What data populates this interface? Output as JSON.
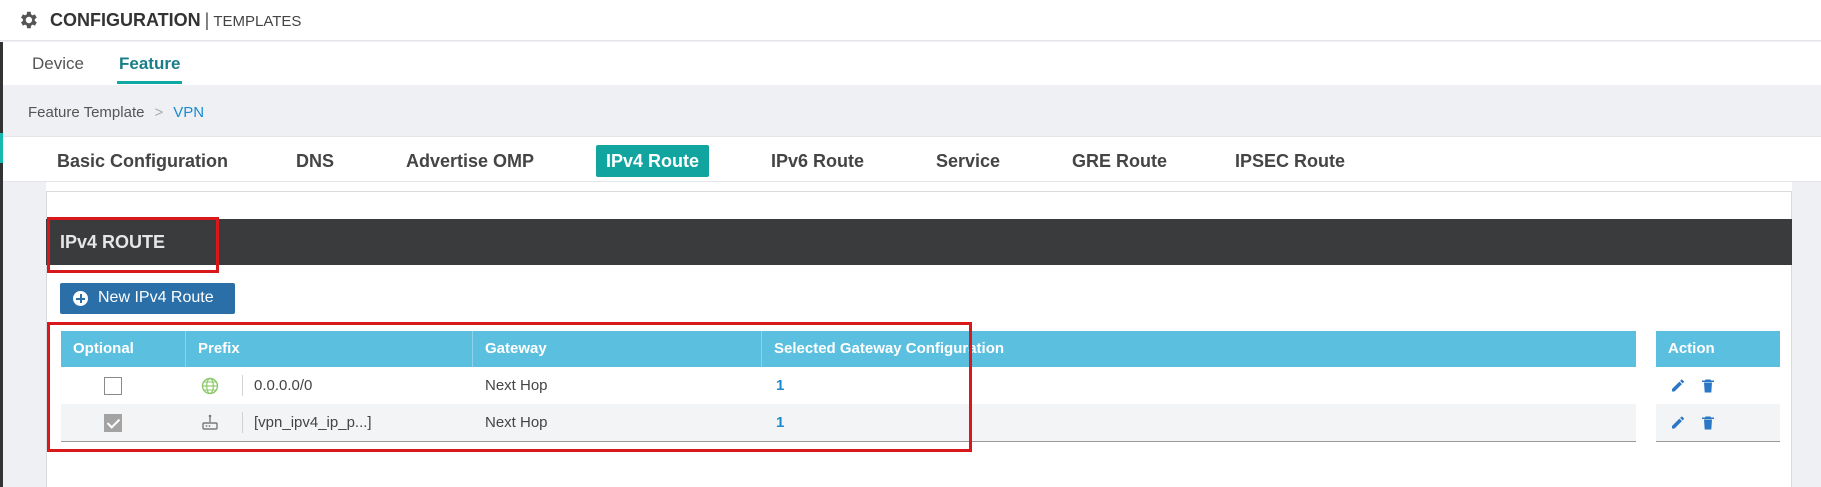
{
  "header": {
    "title": "CONFIGURATION",
    "separator": "|",
    "subtitle": "TEMPLATES",
    "icon": "gear-icon"
  },
  "subtabs": [
    {
      "label": "Device",
      "active": false
    },
    {
      "label": "Feature",
      "active": true
    }
  ],
  "breadcrumb": {
    "parent": "Feature Template",
    "arrow": ">",
    "current": "VPN"
  },
  "tabs": [
    {
      "label": "Basic Configuration",
      "active": false
    },
    {
      "label": "DNS",
      "active": false
    },
    {
      "label": "Advertise OMP",
      "active": false
    },
    {
      "label": "IPv4 Route",
      "active": true
    },
    {
      "label": "IPv6 Route",
      "active": false
    },
    {
      "label": "Service",
      "active": false
    },
    {
      "label": "GRE Route",
      "active": false
    },
    {
      "label": "IPSEC Route",
      "active": false
    }
  ],
  "section": {
    "title": "IPv4 ROUTE"
  },
  "new_button": {
    "label": "New IPv4 Route",
    "icon": "plus-circle-icon"
  },
  "table": {
    "columns": [
      "Optional",
      "Prefix",
      "Gateway",
      "Selected Gateway Configuration"
    ],
    "action_column": "Action",
    "rows": [
      {
        "optional": false,
        "prefix_icon": "globe-icon",
        "prefix": "0.0.0.0/0",
        "gateway": "Next Hop",
        "selected_gateway_configuration": "1",
        "actions": [
          "edit-icon",
          "trash-icon"
        ]
      },
      {
        "optional": true,
        "prefix_icon": "device-variable-icon",
        "prefix": "[vpn_ipv4_ip_p...]",
        "gateway": "Next Hop",
        "selected_gateway_configuration": "1",
        "actions": [
          "edit-icon",
          "trash-icon"
        ]
      }
    ]
  },
  "colors": {
    "accent_teal": "#12a59f",
    "table_header": "#5bbfdf",
    "section_header": "#3a3b3d",
    "button_blue": "#2a6fa8",
    "link_blue": "#1a8ad1",
    "highlight_red": "#d9181c"
  }
}
